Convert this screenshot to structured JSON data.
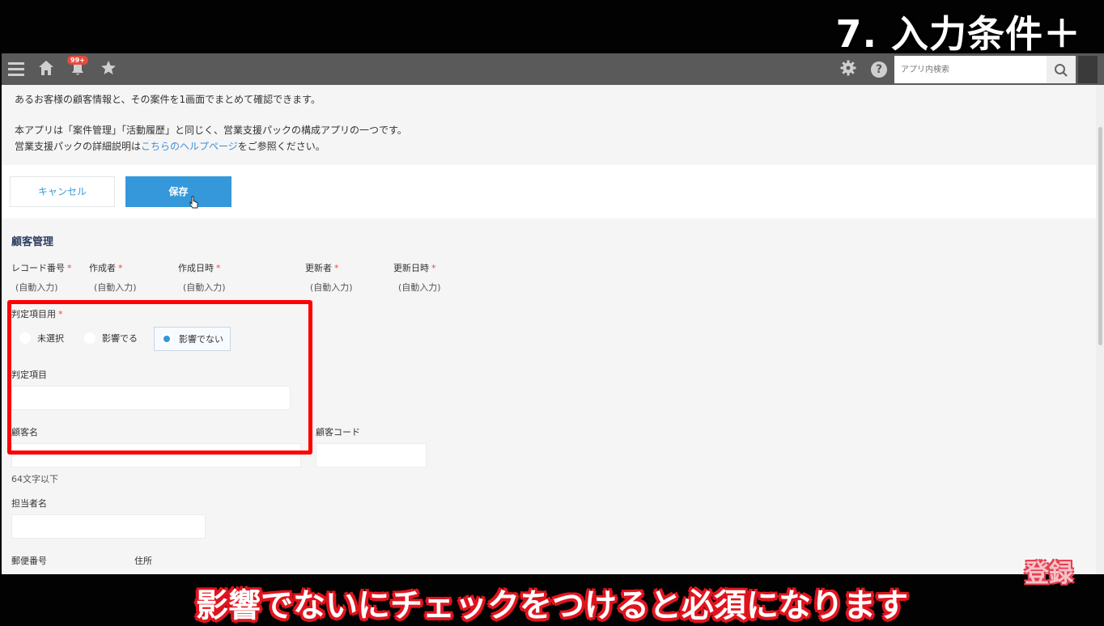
{
  "overlay": {
    "headline": "7. 入力条件＋",
    "caption": "影響でないにチェックをつけると必須になります",
    "subscribe": "登録"
  },
  "header": {
    "badge": "99+",
    "search_placeholder": "アプリ内検索"
  },
  "description": {
    "line1": "あるお客様の顧客情報と、その案件を1画面でまとめて確認できます。",
    "line2": "本アプリは「案件管理」「活動履歴」と同じく、営業支援パックの構成アプリの一つです。",
    "line3_prefix": "営業支援パックの詳細説明は",
    "line3_link": "こちらのヘルプページ",
    "line3_suffix": "をご参照ください。"
  },
  "actions": {
    "cancel_label": "キャンセル",
    "save_label": "保存"
  },
  "form": {
    "section_title": "顧客管理",
    "meta_fields": [
      {
        "label": "レコード番号",
        "value": "(自動入力)"
      },
      {
        "label": "作成者",
        "value": "(自動入力)"
      },
      {
        "label": "作成日時",
        "value": "(自動入力)"
      },
      {
        "label": "更新者",
        "value": "(自動入力)"
      },
      {
        "label": "更新日時",
        "value": "(自動入力)"
      }
    ],
    "required_mark": "*",
    "judge_radio": {
      "label": "判定項目用",
      "options": [
        "未選択",
        "影響でる",
        "影響でない"
      ],
      "selected": "影響でない"
    },
    "judge_item_label": "判定項目",
    "customer_name_label": "顧客名",
    "customer_code_label": "顧客コード",
    "customer_name_hint": "64文字以下",
    "person_label": "担当者名",
    "postal_label": "郵便番号",
    "address_label": "住所"
  },
  "colors": {
    "header_bg": "#5a5a5a",
    "accent": "#3498db",
    "required": "#e74c3c",
    "highlight": "#ff0000",
    "caption_outline": "#e0141e"
  }
}
